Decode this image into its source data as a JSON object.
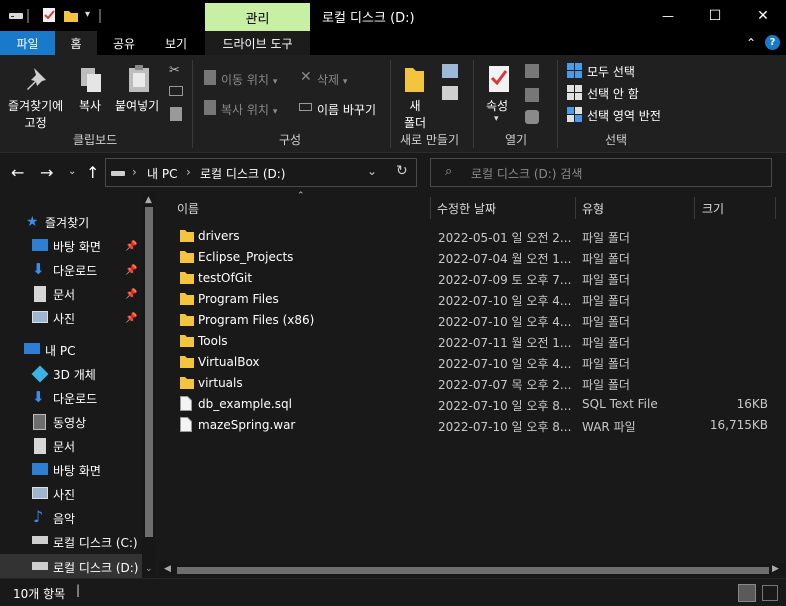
{
  "window": {
    "context_tab": "관리",
    "title": "로컬 디스크 (D:)",
    "minimize_glyph": "—",
    "maximize_glyph": "☐",
    "close_glyph": "✕"
  },
  "ribbon_tabs": {
    "file": "파일",
    "home": "홈",
    "share": "공유",
    "view": "보기",
    "drive_tools": "드라이브 도구",
    "collapse_glyph": "⌃",
    "help_glyph": "?"
  },
  "ribbon": {
    "pin_quick_access": [
      "즐겨찾기에",
      "고정"
    ],
    "copy": "복사",
    "paste": "붙여넣기",
    "clipboard_group": "클립보드",
    "move_to": "이동 위치",
    "copy_to": "복사 위치",
    "delete": "삭제",
    "rename": "이름 바꾸기",
    "organize_group": "구성",
    "new_folder": [
      "새",
      "폴더"
    ],
    "new_group": "새로 만들기",
    "properties": "속성",
    "open_group": "열기",
    "select_all": "모두 선택",
    "select_none": "선택 안 함",
    "invert_selection": "선택 영역 반전",
    "select_group": "선택"
  },
  "navigation": {
    "address_segments": [
      "내 PC",
      "로컬 디스크 (D:)"
    ],
    "search_placeholder": "로컬 디스크 (D:) 검색"
  },
  "nav_pane": {
    "quick_access": "즐겨찾기",
    "quick_items": [
      "바탕 화면",
      "다운로드",
      "문서",
      "사진"
    ],
    "this_pc": "내 PC",
    "pc_items": [
      "3D 개체",
      "다운로드",
      "동영상",
      "문서",
      "바탕 화면",
      "사진",
      "음악",
      "로컬 디스크 (C:)",
      "로컬 디스크 (D:)"
    ]
  },
  "columns": {
    "name": "이름",
    "modified": "수정한 날짜",
    "type": "유형",
    "size": "크기"
  },
  "files": [
    {
      "name": "drivers",
      "modified": "2022-05-01 일 오전 2...",
      "type": "파일 폴더",
      "size": "",
      "kind": "folder"
    },
    {
      "name": "Eclipse_Projects",
      "modified": "2022-07-04 월 오전 1...",
      "type": "파일 폴더",
      "size": "",
      "kind": "folder"
    },
    {
      "name": "testOfGit",
      "modified": "2022-07-09 토 오후 7...",
      "type": "파일 폴더",
      "size": "",
      "kind": "folder"
    },
    {
      "name": "Program Files",
      "modified": "2022-07-10 일 오후 4...",
      "type": "파일 폴더",
      "size": "",
      "kind": "folder"
    },
    {
      "name": "Program Files (x86)",
      "modified": "2022-07-10 일 오후 4...",
      "type": "파일 폴더",
      "size": "",
      "kind": "folder"
    },
    {
      "name": "Tools",
      "modified": "2022-07-11 월 오전 1...",
      "type": "파일 폴더",
      "size": "",
      "kind": "folder"
    },
    {
      "name": "VirtualBox",
      "modified": "2022-07-10 일 오후 4...",
      "type": "파일 폴더",
      "size": "",
      "kind": "folder"
    },
    {
      "name": "virtuals",
      "modified": "2022-07-07 목 오후 2...",
      "type": "파일 폴더",
      "size": "",
      "kind": "folder"
    },
    {
      "name": "db_example.sql",
      "modified": "2022-07-10 일 오후 8...",
      "type": "SQL Text File",
      "size": "16KB",
      "kind": "file"
    },
    {
      "name": "mazeSpring.war",
      "modified": "2022-07-10 일 오후 8...",
      "type": "WAR 파일",
      "size": "16,715KB",
      "kind": "file"
    }
  ],
  "status": {
    "item_count": "10개 항목"
  },
  "colors": {
    "accent": "#1979ca",
    "context_tab": "#c8f0a4",
    "folder": "#f3c43d",
    "background": "#191919"
  }
}
